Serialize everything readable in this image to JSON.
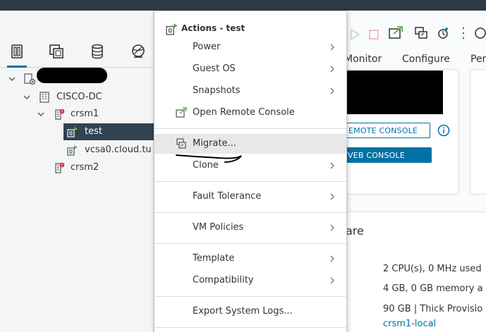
{
  "tree": {
    "datacenter": "CISCO-DC",
    "hosts": [
      {
        "label": "crsm1",
        "vms": [
          {
            "label": "test",
            "selected": true
          },
          {
            "label": "vcsa0.cloud.tu"
          }
        ]
      },
      {
        "label": "crsm2"
      }
    ]
  },
  "tabs": {
    "monitor": "Monitor",
    "configure": "Configure",
    "permissions": "Per"
  },
  "console": {
    "remote_button": "EMOTE CONSOLE",
    "web_button": "VEB CONSOLE"
  },
  "hardware": {
    "title": "are",
    "cpu": "2 CPU(s), 0 MHz used",
    "memory": "4 GB, 0 GB memory a",
    "disk": "90 GB | Thick Provisio",
    "datastore": "crsm1-local"
  },
  "menu": {
    "header": "Actions - test",
    "items": {
      "power": "Power",
      "guest_os": "Guest OS",
      "snapshots": "Snapshots",
      "open_remote_console": "Open Remote Console",
      "migrate": "Migrate...",
      "clone": "Clone",
      "fault_tolerance": "Fault Tolerance",
      "vm_policies": "VM Policies",
      "template": "Template",
      "compatibility": "Compatibility",
      "export_system_logs": "Export System Logs..."
    }
  },
  "colors": {
    "accent": "#0072a3",
    "topbar": "#2e3a44",
    "selected_row": "#314351",
    "vm_running_green": "#5ab04a",
    "alert_red": "#e0312b"
  }
}
